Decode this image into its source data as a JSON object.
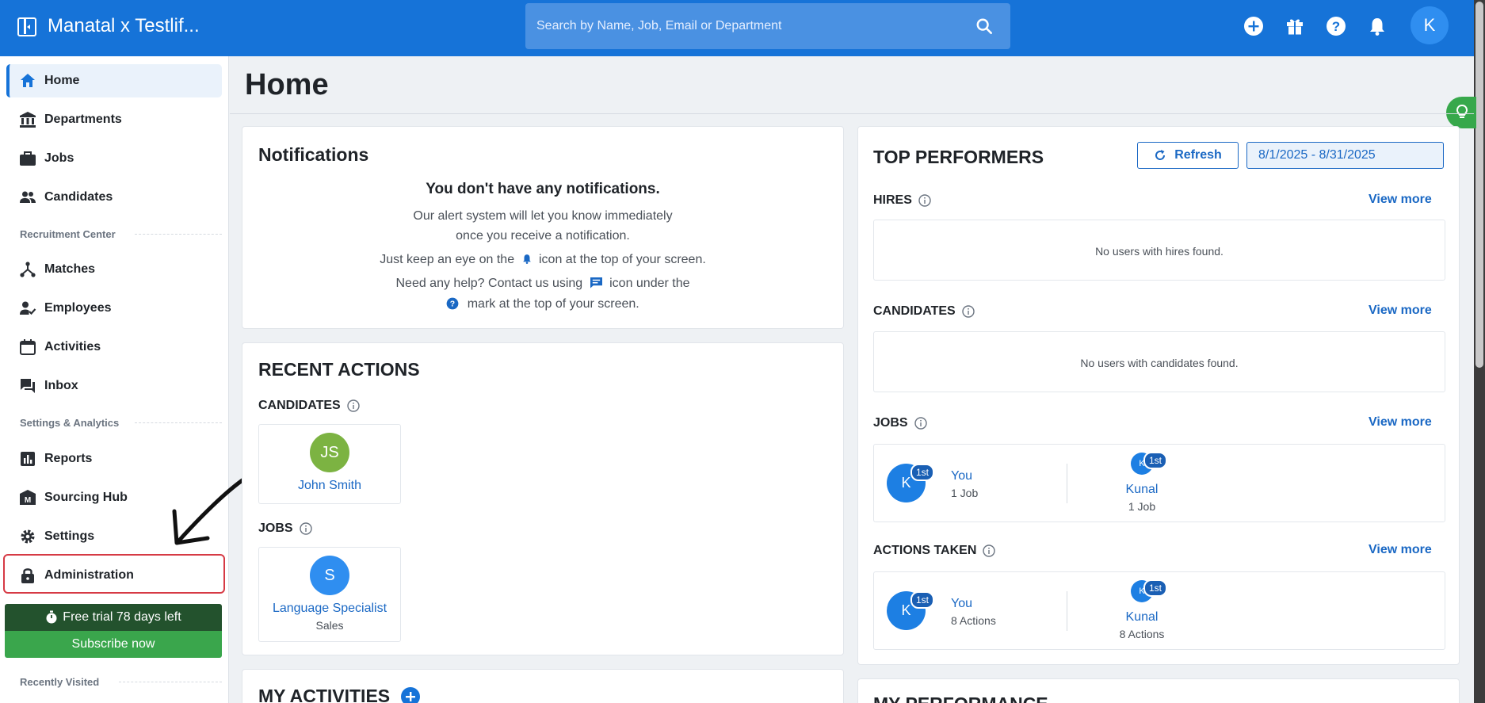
{
  "header": {
    "title": "Manatal x Testlif...",
    "search_placeholder": "Search by Name, Job, Email or Department",
    "avatar_initial": "K"
  },
  "colors": {
    "primary": "#1673d8",
    "success": "#3aa64c",
    "danger": "#d63a45",
    "trial": "#23522d"
  },
  "sidebar": {
    "items": [
      {
        "label": "Home",
        "icon": "home-icon"
      },
      {
        "label": "Departments",
        "icon": "bank-icon"
      },
      {
        "label": "Jobs",
        "icon": "briefcase-icon"
      },
      {
        "label": "Candidates",
        "icon": "people-icon"
      },
      {
        "label": "Matches",
        "icon": "network-icon"
      },
      {
        "label": "Employees",
        "icon": "person-check-icon"
      },
      {
        "label": "Activities",
        "icon": "calendar-icon"
      },
      {
        "label": "Inbox",
        "icon": "chat-icon"
      },
      {
        "label": "Reports",
        "icon": "chart-icon"
      },
      {
        "label": "Sourcing Hub",
        "icon": "sourcing-icon"
      },
      {
        "label": "Settings",
        "icon": "gear-icon"
      },
      {
        "label": "Administration",
        "icon": "lock-icon"
      }
    ],
    "section_recruitment": "Recruitment Center",
    "section_settings": "Settings & Analytics",
    "trial_text": "Free trial 78 days left",
    "subscribe_label": "Subscribe now",
    "recently_visited": "Recently Visited"
  },
  "main": {
    "page_title": "Home",
    "notifications": {
      "title": "Notifications",
      "heading": "You don't have any notifications.",
      "line1": "Our alert system will let you know immediately",
      "line2": "once you receive a notification.",
      "line3a": "Just keep an eye on the",
      "line3b": "icon at the top of your screen.",
      "line4a": "Need any help? Contact us using",
      "line4b": "icon under the",
      "line5": "mark at the top of your screen."
    },
    "recent_actions": {
      "title": "RECENT ACTIONS",
      "candidates_label": "CANDIDATES",
      "candidate": {
        "initials": "JS",
        "name": "John Smith"
      },
      "jobs_label": "JOBS",
      "job": {
        "initial": "S",
        "name": "Language Specialist",
        "department": "Sales"
      }
    },
    "my_activities": {
      "title": "MY ACTIVITIES"
    },
    "top_performers": {
      "title": "TOP PERFORMERS",
      "refresh_label": "Refresh",
      "date_range": "8/1/2025 - 8/31/2025",
      "view_more": "View more",
      "hires": {
        "label": "HIRES",
        "empty": "No users with hires found."
      },
      "candidates": {
        "label": "CANDIDATES",
        "empty": "No users with candidates found."
      },
      "jobs": {
        "label": "JOBS",
        "users": [
          {
            "initial": "K",
            "rank": "1st",
            "name": "You",
            "detail": "1 Job"
          },
          {
            "initial": "K",
            "rank": "1st",
            "name": "Kunal",
            "detail": "1 Job"
          }
        ]
      },
      "actions_taken": {
        "label": "ACTIONS TAKEN",
        "users": [
          {
            "initial": "K",
            "rank": "1st",
            "name": "You",
            "detail": "8 Actions"
          },
          {
            "initial": "K",
            "rank": "1st",
            "name": "Kunal",
            "detail": "8 Actions"
          }
        ]
      }
    },
    "my_performance": {
      "title": "MY PERFORMANCE"
    }
  }
}
